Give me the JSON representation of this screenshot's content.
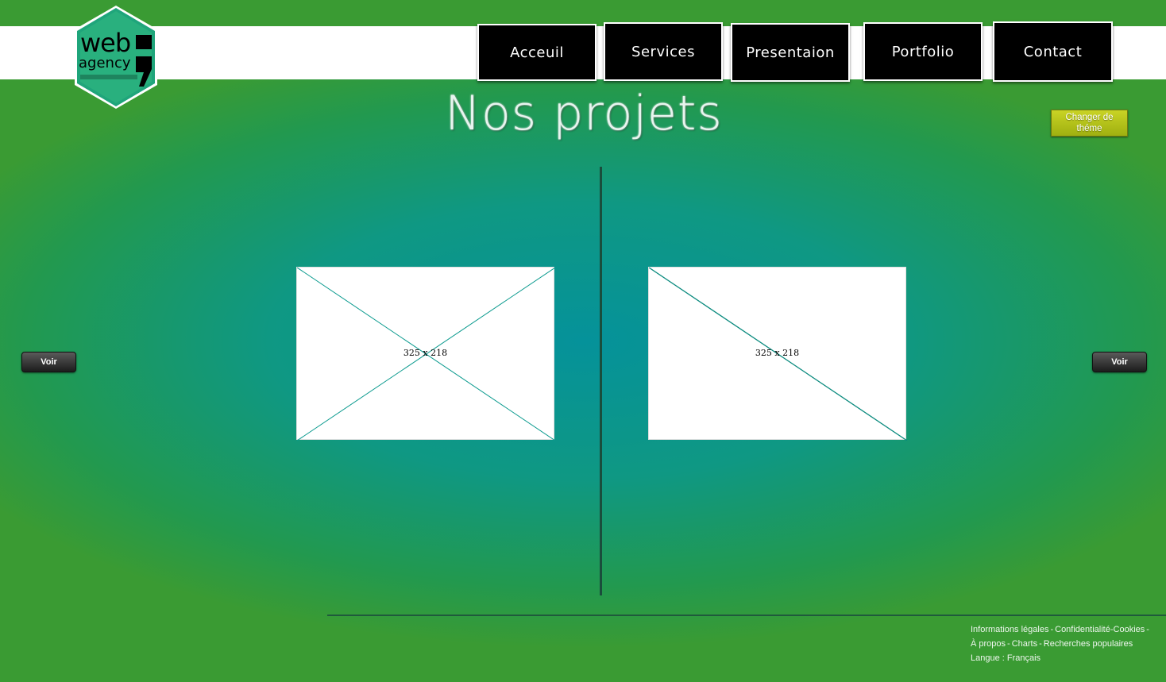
{
  "logo": {
    "line1": "web",
    "line2": "agency",
    "icon": "hexagon-logo-icon",
    "color": "#22a37a"
  },
  "nav": {
    "items": [
      {
        "label": "Acceuil"
      },
      {
        "label": "Services"
      },
      {
        "label": "Presentaion"
      },
      {
        "label": "Portfolio"
      },
      {
        "label": "Contact"
      }
    ]
  },
  "main": {
    "title": "Nos projets",
    "theme_button": "Changer de théme",
    "projects": [
      {
        "placeholder": "325 x 218",
        "button": "Voir"
      },
      {
        "placeholder": "325 x 218",
        "button": "Voir"
      }
    ]
  },
  "footer": {
    "links": [
      "Informations légales",
      "Confidentialité",
      "Cookies",
      "À propos",
      "Charts",
      "Recherches populaires",
      "Langue : Français"
    ]
  },
  "colors": {
    "bg_center": "#05929a",
    "bg_edge": "#3a9b33",
    "nav_bg": "#000000",
    "theme_button": "#b7c41c"
  }
}
